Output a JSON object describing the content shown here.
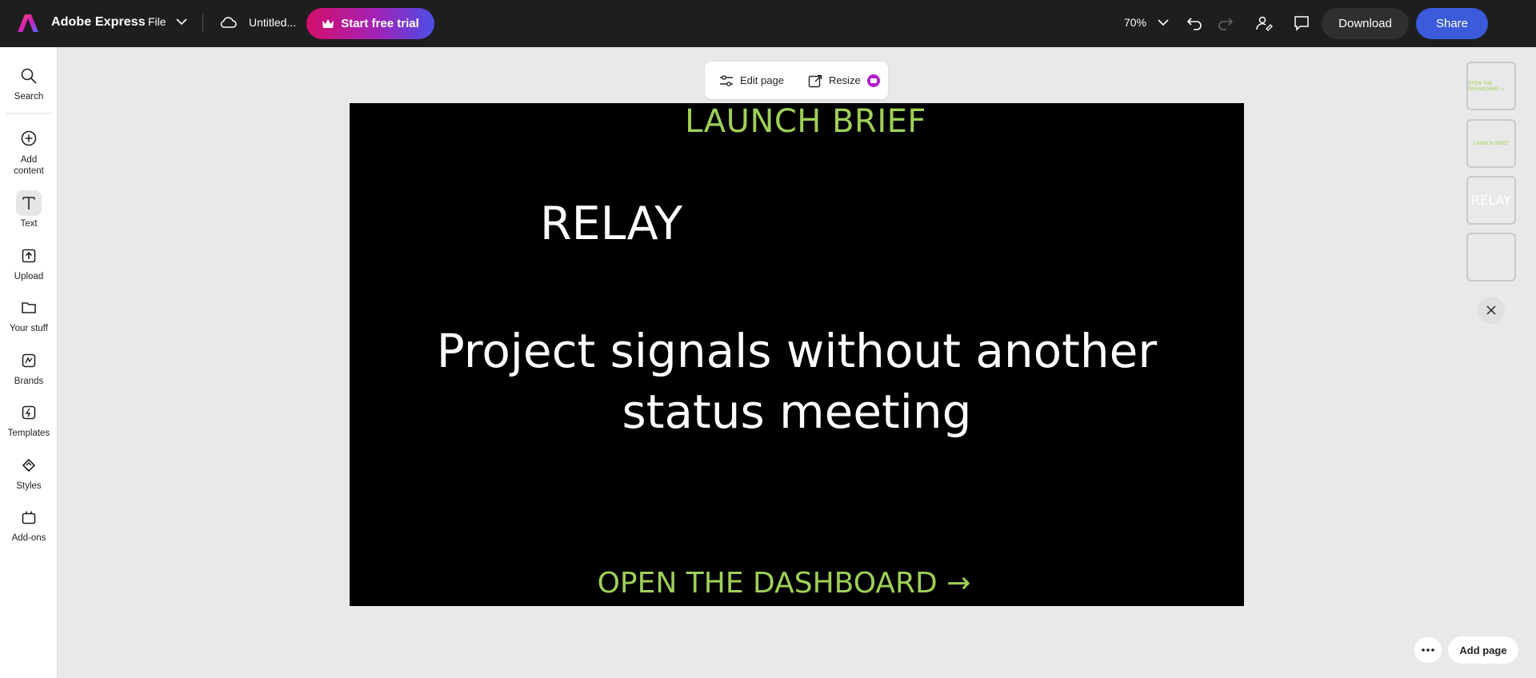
{
  "app": {
    "name": "Adobe Express",
    "file_label": "File",
    "doc_title": "Untitled...",
    "trial_label": "Start free trial",
    "zoom": "70%",
    "download_label": "Download",
    "share_label": "Share"
  },
  "rail": {
    "items": [
      {
        "label": "Search",
        "icon": "search-icon"
      },
      {
        "label": "Add content",
        "icon": "plus-circle-icon"
      },
      {
        "label": "Text",
        "icon": "text-icon"
      },
      {
        "label": "Upload",
        "icon": "upload-icon"
      },
      {
        "label": "Your stuff",
        "icon": "folder-icon"
      },
      {
        "label": "Brands",
        "icon": "brand-icon"
      },
      {
        "label": "Templates",
        "icon": "templates-icon"
      },
      {
        "label": "Styles",
        "icon": "styles-icon"
      },
      {
        "label": "Add-ons",
        "icon": "addons-icon"
      }
    ],
    "active": "Text"
  },
  "page_toolbar": {
    "edit_label": "Edit page",
    "resize_label": "Resize"
  },
  "slide": {
    "background": "#000000",
    "accent": "#9fcf56",
    "brief": "LAUNCH BRIEF",
    "relay": "RELAY",
    "headline": "Project signals without another status meeting",
    "cta": "OPEN THE DASHBOARD →"
  },
  "thumbnails": [
    {
      "label": "OPEN THE DASHBOARD →",
      "style": "accent-small"
    },
    {
      "label": "LAUNCH BRIEF",
      "style": "accent-small"
    },
    {
      "label": "RELAY",
      "style": "white-large"
    },
    {
      "label": "",
      "style": "blank"
    }
  ],
  "bottom": {
    "add_page_label": "Add page"
  }
}
